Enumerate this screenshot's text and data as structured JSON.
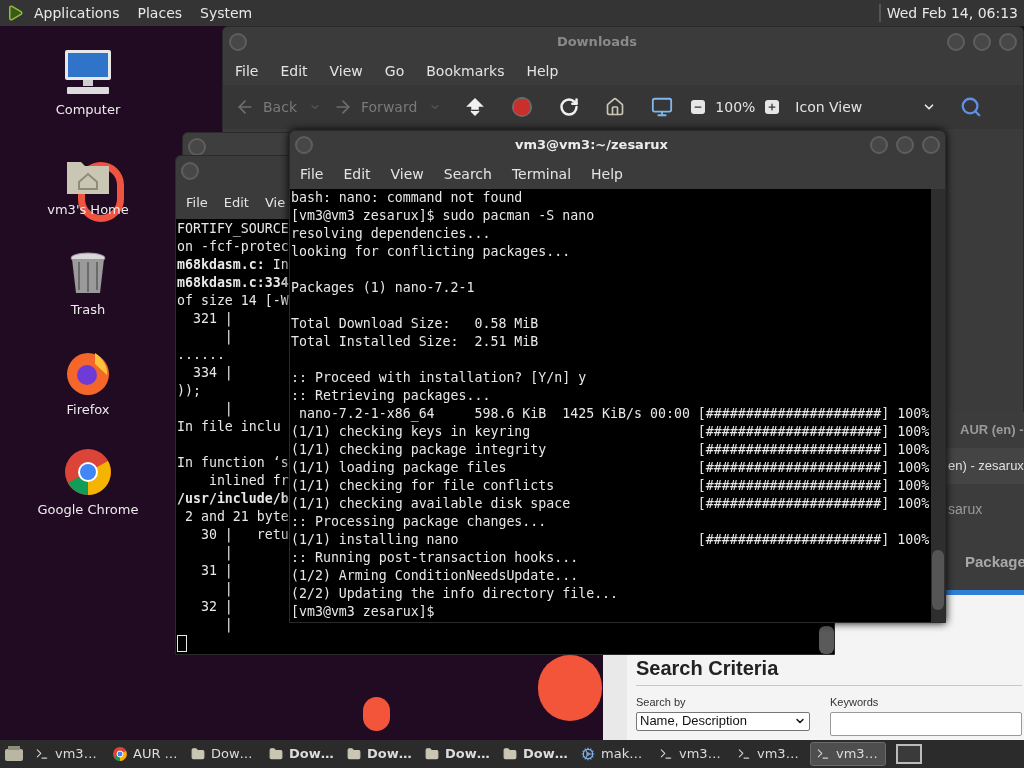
{
  "top_panel": {
    "menus": [
      "Applications",
      "Places",
      "System"
    ],
    "clock": "Wed Feb 14, 06:13"
  },
  "desktop_icons": [
    {
      "kind": "computer",
      "label": "Computer"
    },
    {
      "kind": "home",
      "label": "vm3's Home"
    },
    {
      "kind": "trash",
      "label": "Trash"
    },
    {
      "kind": "firefox",
      "label": "Firefox"
    },
    {
      "kind": "chrome",
      "label": "Google Chrome"
    }
  ],
  "file_manager": {
    "title": "Downloads",
    "menu": [
      "File",
      "Edit",
      "View",
      "Go",
      "Bookmarks",
      "Help"
    ],
    "back": {
      "label": "Back",
      "disabled": true
    },
    "forward": {
      "label": "Forward",
      "disabled": true
    },
    "zoom": "100%",
    "view_mode": "Icon View"
  },
  "back_terminal": {
    "menu": [
      "File",
      "Edit",
      "Vie"
    ],
    "lines": [
      {
        "kind": "text",
        "text": "FORTIFY_SOURCE"
      },
      {
        "kind": "text",
        "text": "on -fcf-protec"
      },
      {
        "kind": "text",
        "text": "**m68kdasm.c:** In"
      },
      {
        "kind": "text",
        "text": "**m68kdasm.c:334**"
      },
      {
        "kind": "text",
        "text": "of size 14 [-W"
      },
      {
        "kind": "text",
        "text": "  321 |"
      },
      {
        "kind": "text",
        "text": "      |"
      },
      {
        "kind": "text",
        "text": "......"
      },
      {
        "kind": "text",
        "text": "  334 |"
      },
      {
        "kind": "text",
        "text": "));"
      },
      {
        "kind": "text",
        "text": "      |"
      },
      {
        "kind": "text",
        "text": "In file inclu"
      },
      {
        "kind": "blank"
      },
      {
        "kind": "text",
        "text": "In function ‘s"
      },
      {
        "kind": "text",
        "text": "    inlined fr"
      },
      {
        "kind": "text",
        "text": "**/usr/include/b**"
      },
      {
        "kind": "text",
        "text": " 2 and 21 byte"
      },
      {
        "kind": "text",
        "text": "   30 |   retu"
      },
      {
        "kind": "text",
        "text": "      |"
      },
      {
        "kind": "text",
        "text": "   31 |"
      },
      {
        "kind": "text",
        "text": "      |"
      },
      {
        "kind": "text",
        "text": "   32 |"
      },
      {
        "kind": "text",
        "text": "      |"
      }
    ]
  },
  "terminal": {
    "title": "vm3@vm3:~/zesarux",
    "menu": [
      "File",
      "Edit",
      "View",
      "Search",
      "Terminal",
      "Help"
    ],
    "lines": [
      {
        "kind": "text",
        "text": "bash: nano: command not found"
      },
      {
        "kind": "text",
        "text": "[vm3@vm3 zesarux]$ sudo pacman -S nano"
      },
      {
        "kind": "text",
        "text": "resolving dependencies..."
      },
      {
        "kind": "text",
        "text": "looking for conflicting packages..."
      },
      {
        "kind": "blank"
      },
      {
        "kind": "text",
        "text": "Packages (1) nano-7.2-1"
      },
      {
        "kind": "blank"
      },
      {
        "kind": "text",
        "text": "Total Download Size:   0.58 MiB"
      },
      {
        "kind": "text",
        "text": "Total Installed Size:  2.51 MiB"
      },
      {
        "kind": "blank"
      },
      {
        "kind": "text",
        "text": ":: Proceed with installation? [Y/n] y"
      },
      {
        "kind": "text",
        "text": ":: Retrieving packages..."
      },
      {
        "kind": "progress",
        "text": " nano-7.2-1-x86_64     598.6 KiB  1425 KiB/s 00:00",
        "bar": "[######################] 100%"
      },
      {
        "kind": "progress",
        "text": "(1/1) checking keys in keyring",
        "bar": "[######################] 100%"
      },
      {
        "kind": "progress",
        "text": "(1/1) checking package integrity",
        "bar": "[######################] 100%"
      },
      {
        "kind": "progress",
        "text": "(1/1) loading package files",
        "bar": "[######################] 100%"
      },
      {
        "kind": "progress",
        "text": "(1/1) checking for file conflicts",
        "bar": "[######################] 100%"
      },
      {
        "kind": "progress",
        "text": "(1/1) checking available disk space",
        "bar": "[######################] 100%"
      },
      {
        "kind": "text",
        "text": ":: Processing package changes..."
      },
      {
        "kind": "progress",
        "text": "(1/1) installing nano",
        "bar": "[######################] 100%"
      },
      {
        "kind": "text",
        "text": ":: Running post-transaction hooks..."
      },
      {
        "kind": "text",
        "text": "(1/2) Arming ConditionNeedsUpdate..."
      },
      {
        "kind": "text",
        "text": "(2/2) Updating the info directory file..."
      },
      {
        "kind": "text",
        "text": "[vm3@vm3 zesarux]$"
      }
    ]
  },
  "browser": {
    "tab": "AUR (en) -",
    "texts": [
      "en) - zesarux",
      "sarux"
    ],
    "heading": "Package",
    "section_title": "Search Criteria",
    "search_by": {
      "label": "Search by",
      "value": "Name, Description"
    },
    "keywords": {
      "label": "Keywords"
    }
  },
  "taskbar": [
    {
      "kind": "terminal",
      "label": "vm3…",
      "bold": false,
      "selected": false
    },
    {
      "kind": "chrome",
      "label": "AUR …",
      "bold": false,
      "selected": false
    },
    {
      "kind": "folder",
      "label": "Dow…",
      "bold": false,
      "selected": false
    },
    {
      "kind": "folder",
      "label": "Dow…",
      "bold": true,
      "selected": false
    },
    {
      "kind": "folder",
      "label": "Dow…",
      "bold": true,
      "selected": false
    },
    {
      "kind": "folder",
      "label": "Dow…",
      "bold": true,
      "selected": false
    },
    {
      "kind": "folder",
      "label": "Dow…",
      "bold": true,
      "selected": false
    },
    {
      "kind": "app",
      "label": "mak…",
      "bold": false,
      "selected": false
    },
    {
      "kind": "terminal",
      "label": "vm3…",
      "bold": false,
      "selected": false
    },
    {
      "kind": "terminal",
      "label": "vm3…",
      "bold": false,
      "selected": false
    },
    {
      "kind": "terminal",
      "label": "vm3…",
      "bold": false,
      "selected": true
    }
  ]
}
